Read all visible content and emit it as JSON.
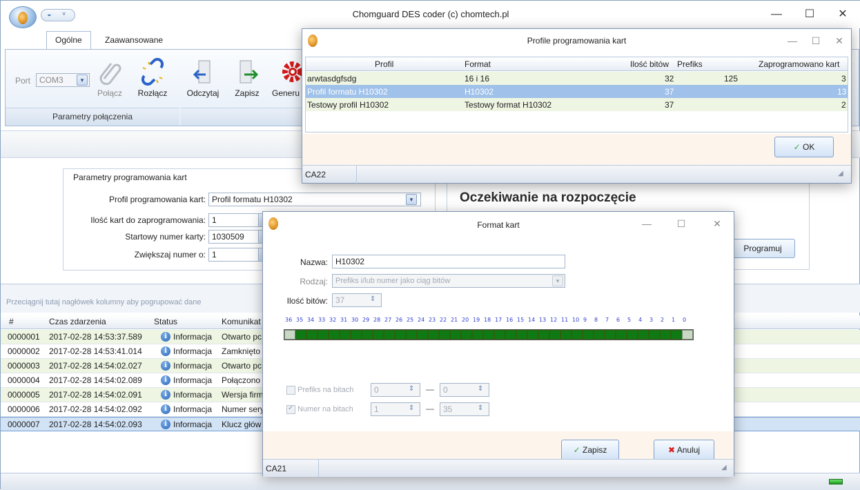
{
  "app": {
    "title": "Chomguard DES coder (c) chomtech.pl"
  },
  "window_controls": {
    "minimize": "—",
    "maximize": "☐",
    "close": "✕"
  },
  "ribbon": {
    "tabs": [
      "Ogólne",
      "Zaawansowane"
    ],
    "port_label": "Port",
    "port_value": "COM3",
    "connect_label": "Połącz",
    "disconnect_label": "Rozłącz",
    "read_label": "Odczytaj",
    "save_label": "Zapisz",
    "generate_label": "Generu",
    "group_connection": "Parametry połączenia"
  },
  "params": {
    "title": "Parametry programowania kart",
    "profile_label": "Profil programowania kart:",
    "profile_value": "Profil formatu H10302",
    "count_label": "Ilość kart do zaprogramowania:",
    "count_value": "1",
    "start_label": "Startowy numer karty:",
    "start_value": "1030509",
    "increment_label": "Zwiększaj numer o:",
    "increment_value": "1"
  },
  "status_panel": {
    "waiting_text": "Oczekiwanie na rozpoczęcie",
    "program_button": "Programuj"
  },
  "log": {
    "group_hint": "Przeciągnij tutaj nagłówek kolumny aby pogrupować dane",
    "columns": [
      "#",
      "Czas zdarzenia",
      "Status",
      "Komunikat"
    ],
    "rows": [
      {
        "id": "0000001",
        "time": "2017-02-28 14:53:37.589",
        "status": "Informacja",
        "message": "Otwarto pc"
      },
      {
        "id": "0000002",
        "time": "2017-02-28 14:53:41.014",
        "status": "Informacja",
        "message": "Zamknięto"
      },
      {
        "id": "0000003",
        "time": "2017-02-28 14:54:02.027",
        "status": "Informacja",
        "message": "Otwarto pc"
      },
      {
        "id": "0000004",
        "time": "2017-02-28 14:54:02.089",
        "status": "Informacja",
        "message": "Połączono"
      },
      {
        "id": "0000005",
        "time": "2017-02-28 14:54:02.091",
        "status": "Informacja",
        "message": "Wersja firm"
      },
      {
        "id": "0000006",
        "time": "2017-02-28 14:54:02.092",
        "status": "Informacja",
        "message": "Numer sery"
      },
      {
        "id": "0000007",
        "time": "2017-02-28 14:54:02.093",
        "status": "Informacja",
        "message": "Klucz głów"
      }
    ]
  },
  "profiles_dialog": {
    "title": "Profile programowania kart",
    "columns": [
      "Profil",
      "Format",
      "Ilość bitów",
      "Prefiks",
      "Zaprogramowano kart"
    ],
    "rows": [
      {
        "profile": "arwtasdgfsdg",
        "format": "16 i 16",
        "bits": "32",
        "prefix": "125",
        "programmed": "3"
      },
      {
        "profile": "Profil formatu H10302",
        "format": "H10302",
        "bits": "37",
        "prefix": "",
        "programmed": "13"
      },
      {
        "profile": "Testowy profil H10302",
        "format": "Testowy format H10302",
        "bits": "37",
        "prefix": "",
        "programmed": "2"
      }
    ],
    "ok_label": "OK",
    "status_text": "CA22"
  },
  "format_dialog": {
    "title": "Format kart",
    "name_label": "Nazwa:",
    "name_value": "H10302",
    "type_label": "Rodzaj:",
    "type_value": "Prefiks i/lub numer jako ciąg bitów",
    "bits_label": "Ilość bitów:",
    "bits_value": "37",
    "bit_numbers": [
      "36",
      "35",
      "34",
      "33",
      "32",
      "31",
      "30",
      "29",
      "28",
      "27",
      "26",
      "25",
      "24",
      "23",
      "22",
      "21",
      "20",
      "19",
      "18",
      "17",
      "16",
      "15",
      "14",
      "13",
      "12",
      "11",
      "10",
      "9",
      "8",
      "7",
      "6",
      "5",
      "4",
      "3",
      "2",
      "1",
      "0"
    ],
    "prefix_label": "Prefiks na bitach",
    "prefix_from": "0",
    "prefix_to": "0",
    "dash": "—",
    "number_label": "Numer na bitach",
    "number_from": "1",
    "number_to": "35",
    "save_label": "Zapisz",
    "cancel_label": "Anuluj",
    "status_text": "CA21"
  }
}
